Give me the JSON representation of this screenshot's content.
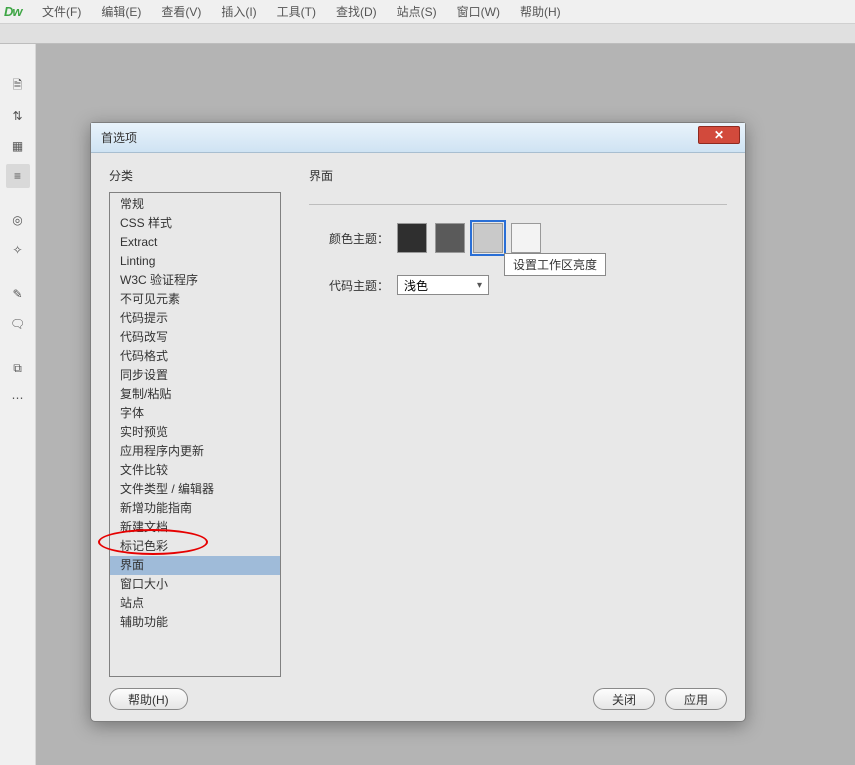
{
  "app": {
    "logo_text": "Dw"
  },
  "menu": [
    "文件(F)",
    "编辑(E)",
    "查看(V)",
    "插入(I)",
    "工具(T)",
    "查找(D)",
    "站点(S)",
    "窗口(W)",
    "帮助(H)"
  ],
  "toolicons": [
    "file-icon",
    "updown-icon",
    "image-icon",
    "align-icon",
    "target-icon",
    "wand-icon",
    "brush-icon",
    "comment-icon",
    "chart-icon",
    "more-icon"
  ],
  "toolicon_glyphs": {
    "file-icon": "🗎",
    "updown-icon": "⇅",
    "image-icon": "▦",
    "align-icon": "≡",
    "target-icon": "◎",
    "wand-icon": "✧",
    "brush-icon": "✎",
    "comment-icon": "🗨",
    "chart-icon": "⧉",
    "more-icon": "⋯"
  },
  "toolicon_selected": "align-icon",
  "dialog": {
    "title": "首选项",
    "category_label": "分类",
    "panel_label": "界面",
    "categories": [
      "常规",
      "CSS 样式",
      "Extract",
      "Linting",
      "W3C 验证程序",
      "不可见元素",
      "代码提示",
      "代码改写",
      "代码格式",
      "同步设置",
      "复制/粘贴",
      "字体",
      "实时预览",
      "应用程序内更新",
      "文件比较",
      "文件类型 / 编辑器",
      "新增功能指南",
      "新建文档",
      "标记色彩",
      "界面",
      "窗口大小",
      "站点",
      "辅助功能"
    ],
    "selected_category_index": 19,
    "color_theme_label": "颜色主题：",
    "color_swatches": [
      "#2f2f2f",
      "#5a5a5a",
      "#c9c9c9",
      "#f3f3f3"
    ],
    "selected_swatch_index": 2,
    "swatch_tooltip": "设置工作区亮度",
    "code_theme_label": "代码主题：",
    "code_theme_value": "浅色",
    "help_button": "帮助(H)",
    "close_button": "关闭",
    "apply_button": "应用",
    "close_x": "✕"
  }
}
